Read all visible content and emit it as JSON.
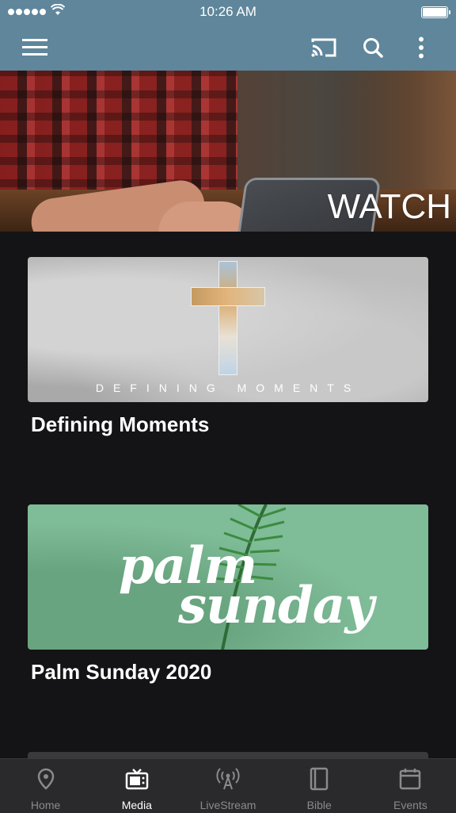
{
  "status_bar": {
    "time": "10:26 AM"
  },
  "app_bar": {
    "menu_icon": "hamburger-icon",
    "actions": [
      "cast-icon",
      "search-icon",
      "more-vertical-icon"
    ]
  },
  "hero": {
    "label": "WATCH"
  },
  "media": [
    {
      "title": "Defining Moments",
      "artwork_caption": "DEFINING MOMENTS"
    },
    {
      "title": "Palm Sunday 2020",
      "artwork_line1": "palm",
      "artwork_line2": "sunday"
    }
  ],
  "tabs": [
    {
      "label": "Home",
      "icon": "location-pin-icon",
      "active": false
    },
    {
      "label": "Media",
      "icon": "tv-icon",
      "active": true
    },
    {
      "label": "LiveStream",
      "icon": "broadcast-icon",
      "active": false
    },
    {
      "label": "Bible",
      "icon": "book-icon",
      "active": false
    },
    {
      "label": "Events",
      "icon": "calendar-icon",
      "active": false
    }
  ],
  "colors": {
    "header": "#5f869b",
    "background": "#141416",
    "tab_bar": "#2a2a2c",
    "tab_inactive": "#8a8a8e"
  }
}
